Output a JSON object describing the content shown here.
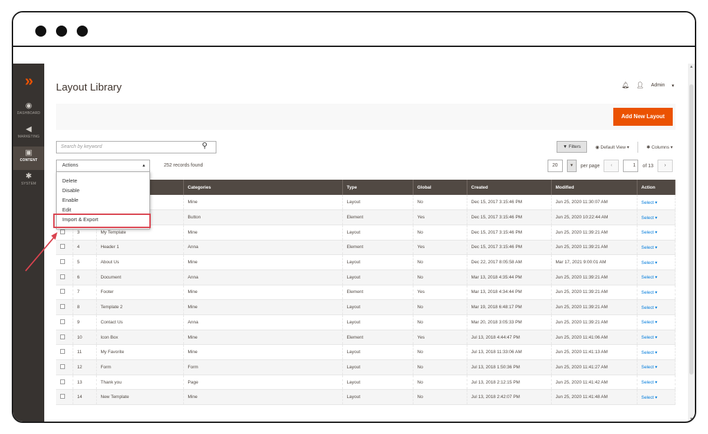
{
  "window": {
    "title": "Layout Library"
  },
  "sidebar": {
    "items": [
      {
        "label": "DASHBOARD",
        "icon": "dashboard-icon"
      },
      {
        "label": "MARKETING",
        "icon": "megaphone-icon"
      },
      {
        "label": "CONTENT",
        "icon": "content-icon"
      },
      {
        "label": "SYSTEM",
        "icon": "gear-icon"
      }
    ]
  },
  "header": {
    "user": "Admin"
  },
  "toolbar": {
    "add_label": "Add New Layout",
    "search_placeholder": "Search by keyword",
    "filters_label": "Filters",
    "view_label": "Default View",
    "columns_label": "Columns",
    "actions_label": "Actions",
    "records": "252 records found",
    "per_page_value": "20",
    "per_page_label": "per page",
    "page_value": "1",
    "page_of": "of 13"
  },
  "actions_menu": [
    "Delete",
    "Disable",
    "Enable",
    "Edit",
    "Import & Export"
  ],
  "grid": {
    "columns": [
      "",
      "",
      "",
      "Categories",
      "Type",
      "Global",
      "Created",
      "Modified",
      "Action"
    ],
    "rows": [
      {
        "id": "",
        "title": "",
        "category": "Mine",
        "type": "Layout",
        "global": "No",
        "created": "Dec 15, 2017 3:15:46 PM",
        "modified": "Jun 25, 2020 11:30:07 AM",
        "action": "Select"
      },
      {
        "id": "",
        "title": "",
        "category": "Button",
        "type": "Element",
        "global": "Yes",
        "created": "Dec 15, 2017 3:15:46 PM",
        "modified": "Jun 25, 2020 10:22:44 AM",
        "action": "Select"
      },
      {
        "id": "3",
        "title": "My Template",
        "category": "Mine",
        "type": "Layout",
        "global": "No",
        "created": "Dec 15, 2017 3:15:46 PM",
        "modified": "Jun 25, 2020 11:39:21 AM",
        "action": "Select"
      },
      {
        "id": "4",
        "title": "Header 1",
        "category": "Anna",
        "type": "Element",
        "global": "Yes",
        "created": "Dec 15, 2017 3:15:46 PM",
        "modified": "Jun 25, 2020 11:39:21 AM",
        "action": "Select"
      },
      {
        "id": "5",
        "title": "About Us",
        "category": "Mine",
        "type": "Layout",
        "global": "No",
        "created": "Dec 22, 2017 8:05:58 AM",
        "modified": "Mar 17, 2021 9:00:01 AM",
        "action": "Select"
      },
      {
        "id": "6",
        "title": "Document",
        "category": "Anna",
        "type": "Layout",
        "global": "No",
        "created": "Mar 13, 2018 4:35:44 PM",
        "modified": "Jun 25, 2020 11:39:21 AM",
        "action": "Select"
      },
      {
        "id": "7",
        "title": "Footer",
        "category": "Mine",
        "type": "Element",
        "global": "Yes",
        "created": "Mar 13, 2018 4:34:44 PM",
        "modified": "Jun 25, 2020 11:39:21 AM",
        "action": "Select"
      },
      {
        "id": "8",
        "title": "Template 2",
        "category": "Mine",
        "type": "Layout",
        "global": "No",
        "created": "Mar 19, 2018 6:48:17 PM",
        "modified": "Jun 25, 2020 11:39:21 AM",
        "action": "Select"
      },
      {
        "id": "9",
        "title": "Contact Us",
        "category": "Anna",
        "type": "Layout",
        "global": "No",
        "created": "Mar 20, 2018 3:05:33 PM",
        "modified": "Jun 25, 2020 11:39:21 AM",
        "action": "Select"
      },
      {
        "id": "10",
        "title": "Icon Box",
        "category": "Mine",
        "type": "Element",
        "global": "Yes",
        "created": "Jul 13, 2018 4:44:47 PM",
        "modified": "Jun 25, 2020 11:41:06 AM",
        "action": "Select"
      },
      {
        "id": "11",
        "title": "My Favorite",
        "category": "Mine",
        "type": "Layout",
        "global": "No",
        "created": "Jul 13, 2018 11:33:06 AM",
        "modified": "Jun 25, 2020 11:41:13 AM",
        "action": "Select"
      },
      {
        "id": "12",
        "title": "Form",
        "category": "Form",
        "type": "Layout",
        "global": "No",
        "created": "Jul 13, 2018 1:50:36 PM",
        "modified": "Jun 25, 2020 11:41:27 AM",
        "action": "Select"
      },
      {
        "id": "13",
        "title": "Thank you",
        "category": "Page",
        "type": "Layout",
        "global": "No",
        "created": "Jul 13, 2018 2:12:15 PM",
        "modified": "Jun 25, 2020 11:41:42 AM",
        "action": "Select"
      },
      {
        "id": "14",
        "title": "New Template",
        "category": "Mine",
        "type": "Layout",
        "global": "No",
        "created": "Jul 13, 2018 2:42:07 PM",
        "modified": "Jun 25, 2020 11:41:48 AM",
        "action": "Select"
      }
    ]
  },
  "colors": {
    "brand": "#eb5202",
    "sidebar": "#373330",
    "header": "#514943",
    "highlight": "#d9434f"
  }
}
